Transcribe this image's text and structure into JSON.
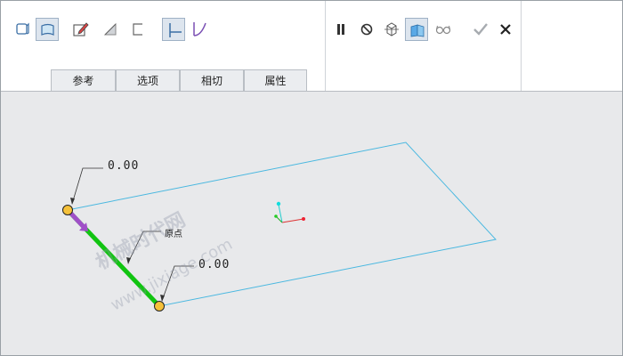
{
  "toolbar": {
    "tabs": [
      {
        "label": "参考"
      },
      {
        "label": "选项"
      },
      {
        "label": "相切"
      },
      {
        "label": "属性"
      }
    ],
    "buttons_left": [
      {
        "icon": "solid-surface-icon"
      },
      {
        "icon": "surface-icon",
        "active": true
      },
      {
        "icon": "sketch-edit-icon"
      },
      {
        "icon": "remove-material-icon"
      },
      {
        "icon": "thin-bracket-icon"
      },
      {
        "icon": "straight-tangent-icon",
        "active": true
      },
      {
        "icon": "curve-tangent-icon"
      }
    ],
    "buttons_right": [
      {
        "icon": "pause-icon"
      },
      {
        "icon": "no-preview-icon"
      },
      {
        "icon": "preview-geometry-icon"
      },
      {
        "icon": "verify-icon",
        "active": true
      },
      {
        "icon": "glasses-icon"
      },
      {
        "icon": "checkmark-icon"
      },
      {
        "icon": "close-icon"
      }
    ]
  },
  "viewport": {
    "dim_top": "0.00",
    "dim_bottom": "0.00",
    "origin_label": "原点",
    "watermark": "机械时代网",
    "watermark_url": "www.jixiage.com",
    "colors": {
      "plane": "#4ab8e0",
      "edge": "#11c411",
      "point": "#f5c13a",
      "arrow": "#a050c8"
    }
  }
}
